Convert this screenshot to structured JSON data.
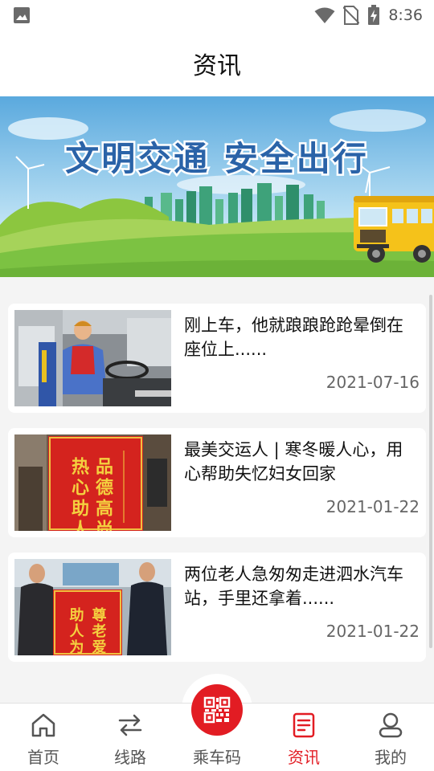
{
  "status_bar": {
    "time": "8:36",
    "icons": [
      "image-icon",
      "wifi-icon",
      "no-sim-icon",
      "battery-charging-icon"
    ]
  },
  "header": {
    "title": "资讯"
  },
  "banner": {
    "slogan": "文明交通 安全出行",
    "colors": {
      "sky": "#6fb8e6",
      "slogan": "#2a63a8",
      "grass": "#7cc242"
    }
  },
  "news": [
    {
      "title": "刚上车，他就踉踉跄跄晕倒在座位上......",
      "date": "2021-07-16",
      "image": "bus-driver-photo"
    },
    {
      "title": "最美交运人 | 寒冬暖人心，用心帮助失忆妇女回家",
      "date": "2021-01-22",
      "image": "red-banner-photo",
      "banner_text_right": "品德高尚",
      "banner_text_left": "热心助人"
    },
    {
      "title": "两位老人急匆匆走进泗水汽车站，手里还拿着......",
      "date": "2021-01-22",
      "image": "elderly-with-banner-photo",
      "banner_text_right": "尊老爱",
      "banner_text_left": "助人为"
    }
  ],
  "tabs": [
    {
      "label": "首页",
      "icon": "home-icon",
      "active": false
    },
    {
      "label": "线路",
      "icon": "route-icon",
      "active": false
    },
    {
      "label": "乘车码",
      "icon": "qr-code-icon",
      "active": false
    },
    {
      "label": "资讯",
      "icon": "news-icon",
      "active": true
    },
    {
      "label": "我的",
      "icon": "user-icon",
      "active": false
    }
  ],
  "colors": {
    "accent": "#e21c23",
    "inactive": "#555555",
    "background": "#f4f4f4"
  }
}
